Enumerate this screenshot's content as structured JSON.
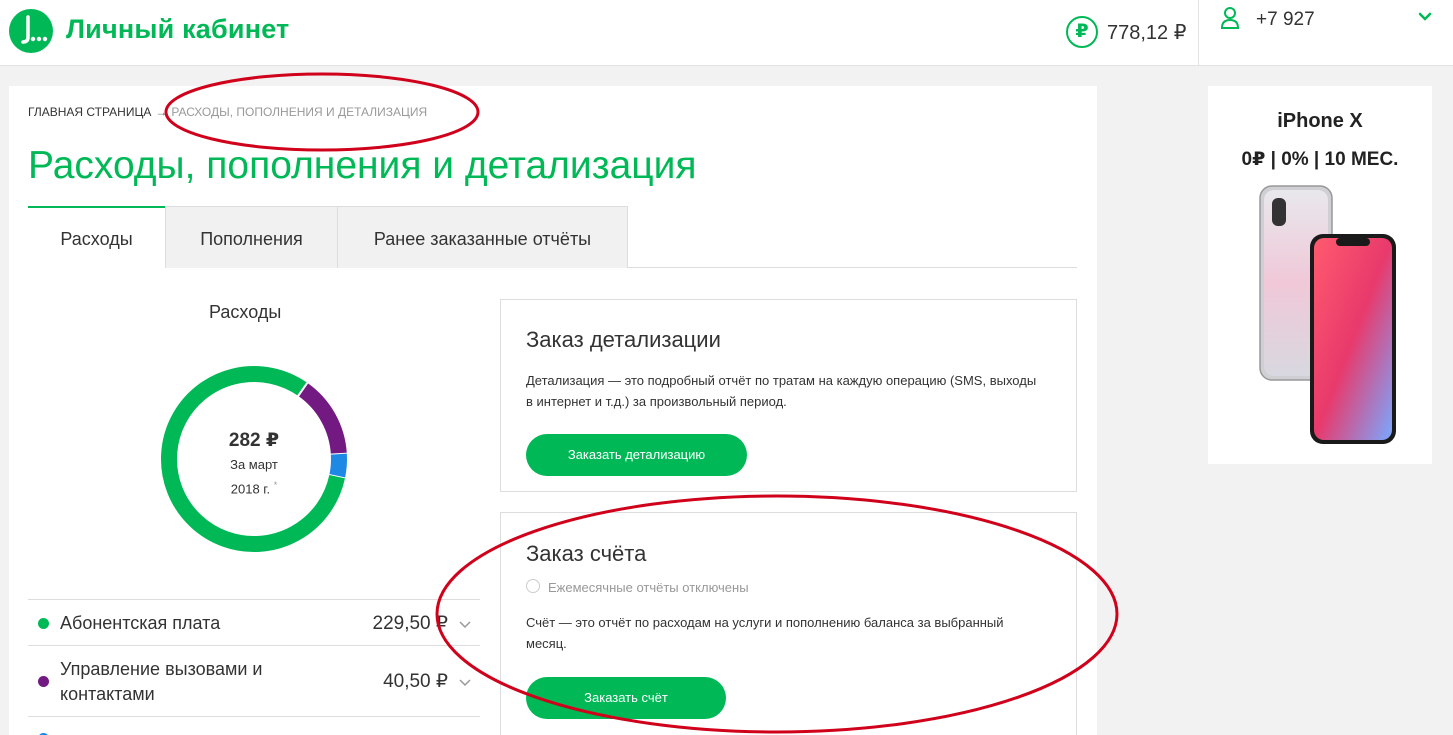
{
  "header": {
    "brand": "Личный кабинет",
    "balance": "778,12 ₽",
    "balance_icon": "ruble-icon",
    "phone": "+7 927"
  },
  "breadcrumb": {
    "home": "ГЛАВНАЯ СТРАНИЦА",
    "separator": "→",
    "current": "РАСХОДЫ, ПОПОЛНЕНИЯ И ДЕТАЛИЗАЦИЯ"
  },
  "page_title": "Расходы, пополнения и детализация",
  "tabs": [
    {
      "label": "Расходы",
      "active": true
    },
    {
      "label": "Пополнения",
      "active": false
    },
    {
      "label": "Ранее заказанные отчёты",
      "active": false
    }
  ],
  "expenses": {
    "title": "Расходы",
    "total": "282 ₽",
    "period_line1": "За март",
    "period_line2": "2018 г.",
    "period_mark": "*",
    "items": [
      {
        "name": "Абонентская плата",
        "value": "229,50 ₽",
        "amount": 229.5,
        "color": "#00b956"
      },
      {
        "name": "Управление вызовами и контактами",
        "value": "40,50 ₽",
        "amount": 40.5,
        "color": "#731982"
      },
      {
        "name": "",
        "value": "",
        "amount": 12,
        "color": "#1e88e5"
      }
    ]
  },
  "detail_card": {
    "title": "Заказ детализации",
    "text": "Детализация — это подробный отчёт по тратам на каждую операцию (SMS, выходы в интернет и т.д.) за произвольный период.",
    "button": "Заказать детализацию"
  },
  "bill_card": {
    "title": "Заказ счёта",
    "radio_label": "Ежемесячные отчёты отключены",
    "text": "Счёт — это отчёт по расходам на услуги и пополнению баланса за выбранный месяц.",
    "button": "Заказать счёт"
  },
  "ad": {
    "brand": "iPhone X",
    "terms": "0₽ | 0% | 10 МЕС."
  },
  "colors": {
    "accent": "#00b956",
    "purple": "#731982",
    "blue": "#1e88e5",
    "annotation": "#d0021b"
  }
}
